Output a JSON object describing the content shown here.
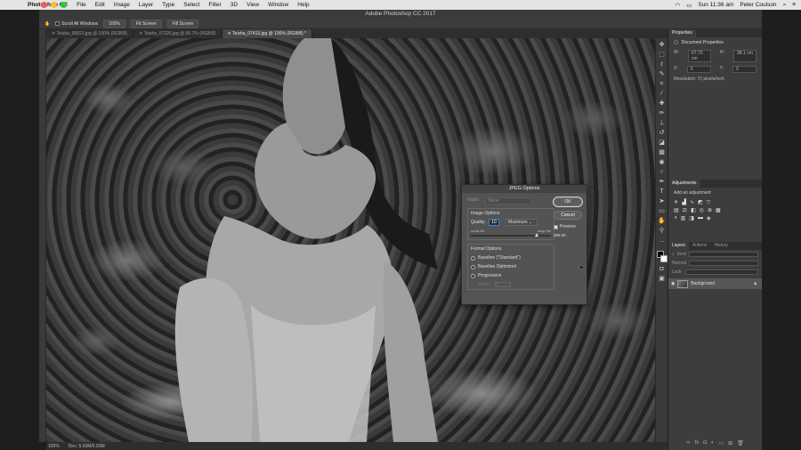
{
  "menubar": {
    "app_name": "Photoshop CC",
    "items": [
      "File",
      "Edit",
      "Image",
      "Layer",
      "Type",
      "Select",
      "Filter",
      "3D",
      "View",
      "Window",
      "Help"
    ],
    "clock": "Sun 11:36 am",
    "user": "Peter Coulson"
  },
  "window": {
    "title": "Adobe Photoshop CC 2017"
  },
  "options": {
    "scroll_all_windows": "Scroll All Windows",
    "zoom_100": "100%",
    "fit_screen": "Fit Screen",
    "fill_screen": "Fill Screen"
  },
  "tabs": [
    {
      "label": "Teisha_06821.jpg @ 100% (RGB/8)"
    },
    {
      "label": "Teisha_07226.jpg @ 66.7% (RGB/8)"
    },
    {
      "label": "Teisha_07413.jpg @ 100% (RGB/8) *"
    }
  ],
  "status": {
    "zoom": "100%",
    "doc": "Doc: 5.93M/5.93M"
  },
  "panels": {
    "properties_tab": "Properties",
    "doc_props": "Document Properties",
    "w_label": "W:",
    "w_value": "67.73 cm",
    "h_label": "H:",
    "h_value": "38.1 cm",
    "x_label": "X:",
    "x_value": "0",
    "y_label": "Y:",
    "y_value": "0",
    "resolution": "Resolution: 72 pixels/inch",
    "adjustments_tab": "Adjustments",
    "add_adjustment": "Add an adjustment",
    "layers_tab": "Layers",
    "actions_tab": "Actions",
    "history_tab": "History",
    "kind": "Kind",
    "normal": "Normal",
    "lock": "Lock:",
    "layer_name": "Background"
  },
  "dialog": {
    "title": "JPEG Options",
    "matte_label": "Matte:",
    "matte_value": "None",
    "image_options": "Image Options",
    "quality_label": "Quality:",
    "quality_value": "10",
    "quality_preset": "Maximum",
    "small_file": "small file",
    "large_file": "large file",
    "quality_fraction": 0.83,
    "format_options": "Format Options",
    "baseline_standard": "Baseline (\"Standard\")",
    "baseline_optimized": "Baseline Optimized",
    "progressive": "Progressive",
    "scans_label": "Scans:",
    "scans_value": "3",
    "ok": "OK",
    "cancel": "Cancel",
    "preview": "Preview",
    "file_size": "399.9K"
  }
}
